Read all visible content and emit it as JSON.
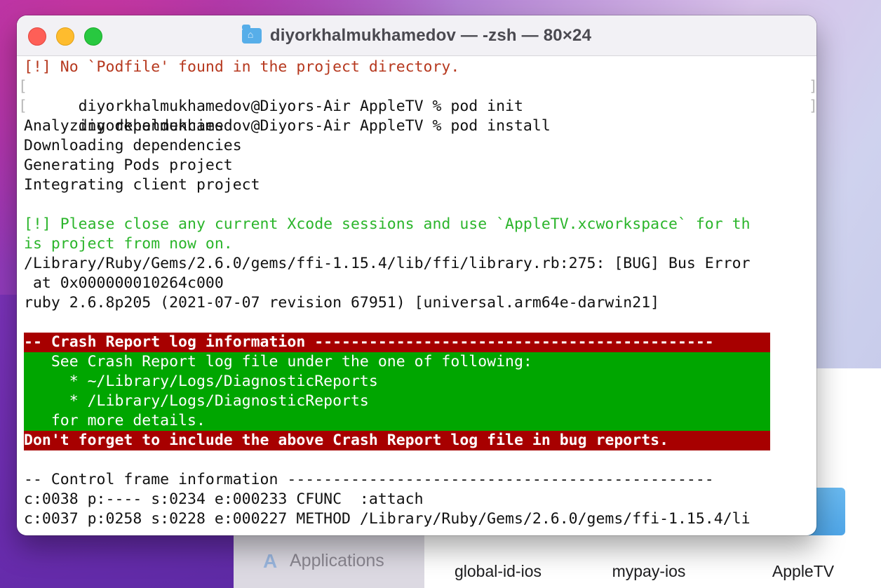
{
  "desktop": {
    "finder": {
      "sidebar_item": "Applications",
      "files": [
        "global-id-ios",
        "mypay-ios",
        "AppleTV"
      ]
    }
  },
  "terminal": {
    "title": "diyorkhalmukhamedov — -zsh — 80×24",
    "lines": {
      "l1": "[!] No `Podfile' found in the project directory.",
      "l2": "diyorkhalmukhamedov@Diyors-Air AppleTV % pod init",
      "l3": "diyorkhalmukhamedov@Diyors-Air AppleTV % pod install",
      "l4": "Analyzing dependencies",
      "l5": "Downloading dependencies",
      "l6": "Generating Pods project",
      "l7": "Integrating client project",
      "l8": "",
      "l9": "[!] Please close any current Xcode sessions and use `AppleTV.xcworkspace` for th",
      "l10": "is project from now on.",
      "l11": "/Library/Ruby/Gems/2.6.0/gems/ffi-1.15.4/lib/ffi/library.rb:275: [BUG] Bus Error",
      "l12": " at 0x000000010264c000",
      "l13": "ruby 2.6.8p205 (2021-07-07 revision 67951) [universal.arm64e-darwin21]",
      "l14": "",
      "l15": "-- Crash Report log information --------------------------------------------",
      "l16": "   See Crash Report log file under the one of following:",
      "l17": "     * ~/Library/Logs/DiagnosticReports",
      "l18": "     * /Library/Logs/DiagnosticReports",
      "l19": "   for more details.",
      "l20": "Don't forget to include the above Crash Report log file in bug reports.",
      "l21": "",
      "l22": "-- Control frame information -----------------------------------------------",
      "l23": "c:0038 p:---- s:0234 e:000233 CFUNC  :attach",
      "l24": "c:0037 p:0258 s:0228 e:000227 METHOD /Library/Ruby/Gems/2.6.0/gems/ffi-1.15.4/li"
    },
    "prompt_open_bracket": "[",
    "prompt_close_bracket": "]"
  },
  "colors": {
    "error_text": "#b6381e",
    "success_text": "#2bb52b",
    "crash_header_bg": "#a70000",
    "crash_body_bg": "#00a600"
  }
}
